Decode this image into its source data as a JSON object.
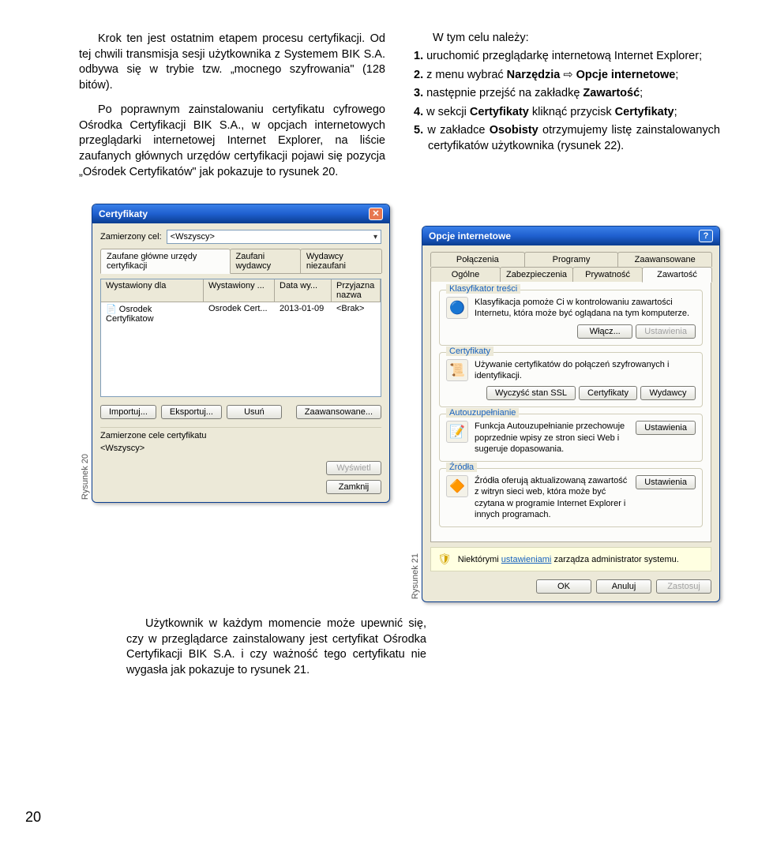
{
  "page_number": "20",
  "left_column": {
    "p1": "Krok ten jest ostatnim etapem procesu certyfikacji. Od tej chwili transmisja sesji użytkownika z Systemem BIK S.A. odbywa się w trybie tzw. „mocnego szyfrowania\" (128 bitów).",
    "p2": "Po poprawnym zainstalowaniu certyfikatu cyfrowego Ośrodka Certyfikacji BIK S.A., w opcjach internetowych przeglądarki internetowej Internet Explorer, na liście zaufanych głównych urzędów certyfikacji pojawi się pozycja „Ośrodek Certyfikatów\" jak pokazuje to rysunek 20."
  },
  "right_column": {
    "heading": "W tym celu należy:",
    "items": [
      {
        "n": "1.",
        "t": " uruchomić przeglądarkę internetową Internet Explorer;"
      },
      {
        "n": "2.",
        "t1": " z menu wybrać ",
        "b1": "Narzędzia",
        "arrow": " ⇨ ",
        "b2": "Opcje internetowe",
        "t2": ";"
      },
      {
        "n": "3.",
        "t1": " następnie przejść na zakładkę ",
        "b1": "Zawartość",
        "t2": ";"
      },
      {
        "n": "4.",
        "t1": " w sekcji ",
        "b1": "Certyfikaty",
        "t2": " kliknąć przycisk ",
        "b2": "Certyfikaty",
        "t3": ";"
      },
      {
        "n": "5.",
        "t1": " w zakładce ",
        "b1": "Osobisty",
        "t2": " otrzymujemy listę zainstalowanych certyfikatów użytkownika (rysunek 22)."
      }
    ]
  },
  "bottom_text": "Użytkownik w każdym momencie może upewnić się, czy w przeglądarce zainstalowany jest certyfikat Ośrodka Certyfikacji BIK S.A. i czy ważność tego certyfikatu nie wygasła jak pokazuje to rysunek 21.",
  "fig20": {
    "label": "Rysunek 20",
    "title": "Certyfikaty",
    "purpose_label": "Zamierzony cel:",
    "purpose_value": "<Wszyscy>",
    "tabs": [
      "Zaufane główne urzędy certyfikacji",
      "Zaufani wydawcy",
      "Wydawcy niezaufani"
    ],
    "cols": [
      "Wystawiony dla",
      "Wystawiony ...",
      "Data wy...",
      "Przyjazna nazwa"
    ],
    "row": [
      "Osrodek Certyfikatow",
      "Osrodek Cert...",
      "2013-01-09",
      "<Brak>"
    ],
    "btns": {
      "import": "Importuj...",
      "export": "Eksportuj...",
      "delete": "Usuń",
      "advanced": "Zaawansowane..."
    },
    "sub_label": "Zamierzone cele certyfikatu",
    "sub_value": "<Wszyscy>",
    "show": "Wyświetl",
    "close": "Zamknij"
  },
  "fig21": {
    "label": "Rysunek 21",
    "title": "Opcje internetowe",
    "tabs_top": [
      "Połączenia",
      "Programy",
      "Zaawansowane"
    ],
    "tabs_bot": [
      "Ogólne",
      "Zabezpieczenia",
      "Prywatność",
      "Zawartość"
    ],
    "g1": {
      "legend": "Klasyfikator treści",
      "text": "Klasyfikacja pomoże Ci w kontrolowaniu zawartości Internetu, która może być oglądana na tym komputerze.",
      "b1": "Włącz...",
      "b2": "Ustawienia"
    },
    "g2": {
      "legend": "Certyfikaty",
      "text": "Używanie certyfikatów do połączeń szyfrowanych i identyfikacji.",
      "b1": "Wyczyść stan SSL",
      "b2": "Certyfikaty",
      "b3": "Wydawcy"
    },
    "g3": {
      "legend": "Autouzupełnianie",
      "text": "Funkcja Autouzupełnianie przechowuje poprzednie wpisy ze stron sieci Web i sugeruje dopasowania.",
      "b1": "Ustawienia"
    },
    "g4": {
      "legend": "Źródła",
      "text": "Źródła oferują aktualizowaną zawartość z witryn sieci web, która może być czytana w programie Internet Explorer i innych programach.",
      "b1": "Ustawienia"
    },
    "info": "Niektórymi ",
    "info_link": "ustawieniami",
    "info2": " zarządza administrator systemu.",
    "ok": "OK",
    "cancel": "Anuluj",
    "apply": "Zastosuj"
  }
}
